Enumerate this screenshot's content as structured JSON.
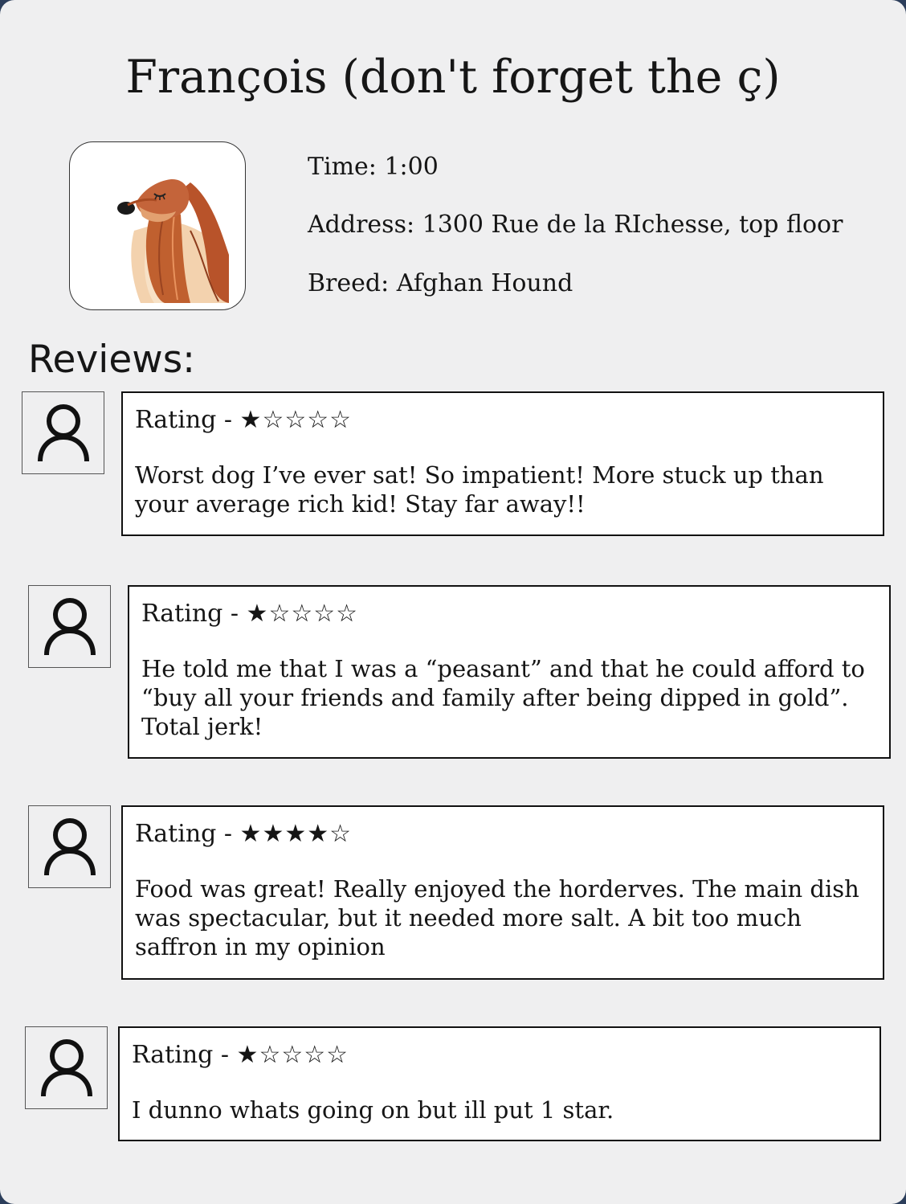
{
  "profile": {
    "name": "François (don't forget the ç)",
    "time": "Time: 1:00",
    "address": "Address: 1300 Rue de la RIchesse, top floor",
    "breed": "Breed: Afghan Hound",
    "photo_icon": "afghan-hound-illustration"
  },
  "reviews_heading": "Reviews:",
  "reviews": [
    {
      "rating_label": "Rating - ",
      "stars": "★☆☆☆☆",
      "rating": 1,
      "text": "Worst dog I’ve ever sat! So impatient! More stuck up than your average rich kid! Stay far away!!"
    },
    {
      "rating_label": "Rating - ",
      "stars": "★☆☆☆☆",
      "rating": 1,
      "text": "He told me that I was a “peasant” and that he could afford to “buy all your friends and family after being dipped in gold”. Total jerk!"
    },
    {
      "rating_label": "Rating - ",
      "stars": "★★★★☆",
      "rating": 4,
      "text": "Food was great! Really enjoyed the horderves. The main dish was spectacular, but it needed more salt. A bit too much saffron in my opinion"
    },
    {
      "rating_label": "Rating - ",
      "stars": "★☆☆☆☆",
      "rating": 1,
      "text": "I dunno whats going on but ill put 1 star."
    }
  ],
  "colors": {
    "page_background": "#efeff0",
    "frame": "#2c3e5b",
    "dog_fur": "#b8532a"
  }
}
